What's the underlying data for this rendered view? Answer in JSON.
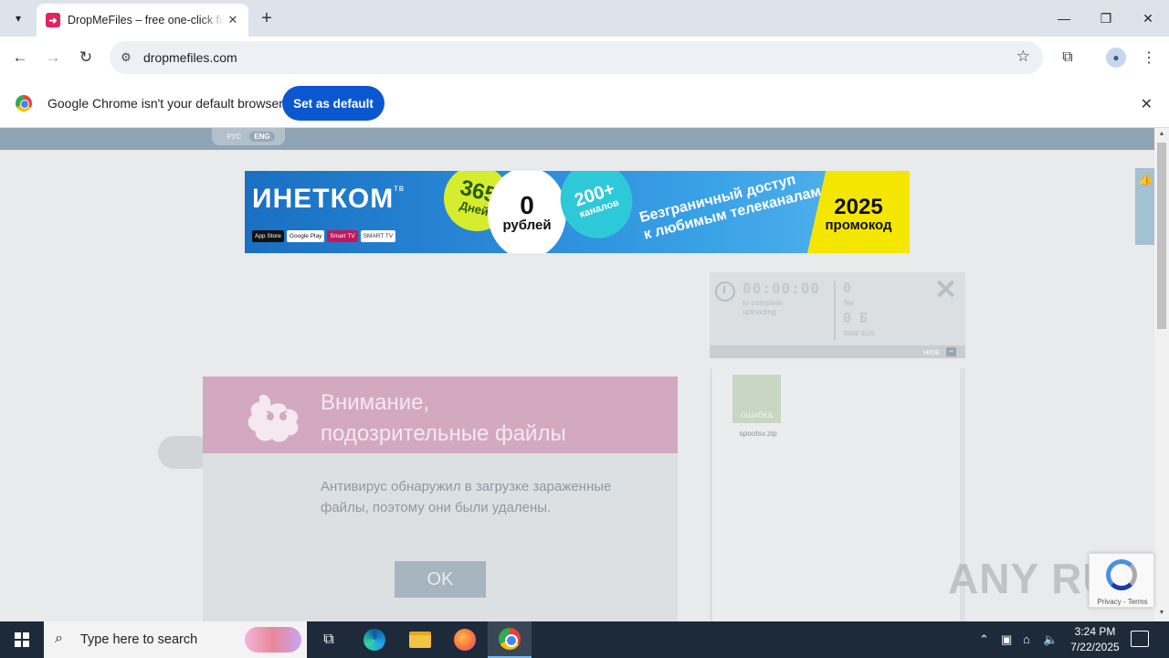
{
  "browser": {
    "tab_title": "DropMeFiles – free one-click file sharing",
    "url": "dropmefiles.com",
    "infobar_text": "Google Chrome isn't your default browser",
    "infobar_button": "Set as default"
  },
  "page": {
    "languages": [
      "РУС",
      "ENG"
    ],
    "active_language": "ENG",
    "banner": {
      "brand": "ИНЕТКОМ",
      "brand_sup": "тв",
      "stores": [
        "App Store",
        "Google Play",
        "Smart TV",
        "SMART TV"
      ],
      "circle1_big": "365",
      "circle1_small": "Дней",
      "circle2_big": "0",
      "circle2_small": "рублей",
      "circle3_big": "200+",
      "circle3_small": "каналов",
      "tagline_1": "Безграничный доступ",
      "tagline_2": "к любимым телеканалам",
      "promo_year": "2025",
      "promo_word": "промокод"
    },
    "stats": {
      "time": "00:00:00",
      "time_label_1": "to complete",
      "time_label_2": "uploading",
      "files_count": "0",
      "files_label": "file",
      "size_value": "0 Б",
      "size_label": "total size",
      "hide_label": "HIDE"
    },
    "file": {
      "status": "ошибка",
      "name": "spoolsv.zip"
    },
    "dialog": {
      "title_1": "Внимание,",
      "title_2": "подозрительные файлы",
      "body": "Антивирус обнаружил в загрузке зараженные файлы, поэтому они были удалены.",
      "ok": "OK"
    },
    "recaptcha_links": "Privacy - Terms"
  },
  "taskbar": {
    "search_placeholder": "Type here to search",
    "time": "3:24 PM",
    "date": "7/22/2025"
  },
  "watermark": "ANY RUN"
}
